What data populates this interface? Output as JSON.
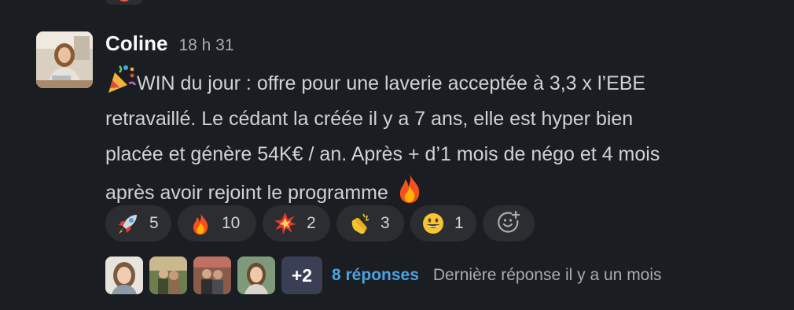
{
  "message": {
    "author": "Coline",
    "time": "18 h 31",
    "lines": [
      "WIN du jour : offre pour une laverie acceptée à 3,3 x l’EBE",
      "retravaillé. Le cédant la créée il y a 7 ans, elle est hyper bien",
      "placée et génère 54K€ / an. Après + d’1 mois de négo et 4 mois",
      "après avoir rejoint le programme"
    ],
    "leading_emoji": "party-popper-icon",
    "trailing_emoji": "fire-icon"
  },
  "reactions": [
    {
      "emoji": "rocket-icon",
      "count": "5"
    },
    {
      "emoji": "fire-icon",
      "count": "10"
    },
    {
      "emoji": "collision-icon",
      "count": "2"
    },
    {
      "emoji": "clapping-hands-icon",
      "count": "3"
    },
    {
      "emoji": "grinning-face-icon",
      "count": "1"
    }
  ],
  "add_reaction_icon": "add-reaction-icon",
  "thread": {
    "more_participants": "+2",
    "replies": "8 réponses",
    "last_reply": "Dernière réponse il y a un mois"
  },
  "colors": {
    "background": "#1a1d21",
    "author": "#f8f8f8",
    "text": "#d1d2d3",
    "muted": "#ababad",
    "link": "#4aa3e0",
    "pill": "#2b2d31"
  }
}
